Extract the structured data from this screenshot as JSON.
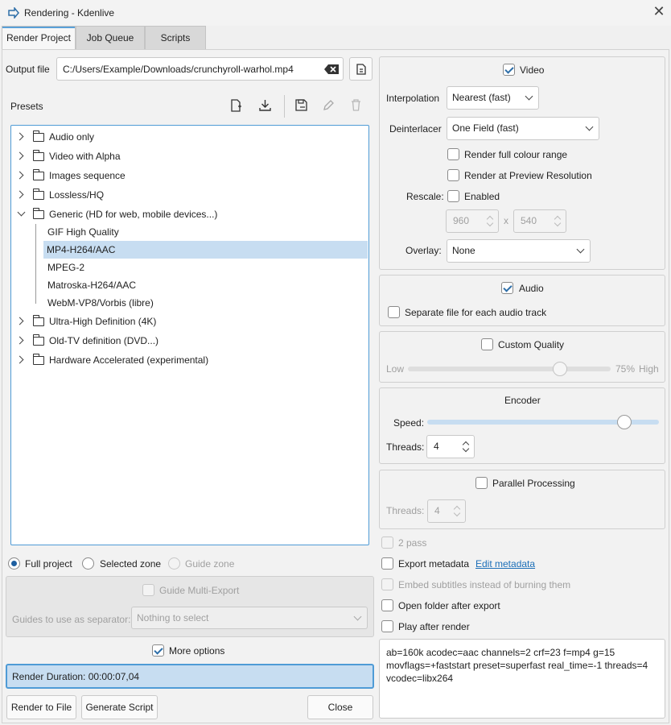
{
  "window": {
    "title": "Rendering - Kdenlive",
    "close_glyph": "✕"
  },
  "tabs": [
    {
      "label": "Render Project"
    },
    {
      "label": "Job Queue"
    },
    {
      "label": "Scripts"
    }
  ],
  "output": {
    "label": "Output file",
    "value": "C:/Users/Example/Downloads/crunchyroll-warhol.mp4"
  },
  "presets": {
    "label": "Presets",
    "tree": [
      {
        "label": "Audio only"
      },
      {
        "label": "Video with Alpha"
      },
      {
        "label": "Images sequence"
      },
      {
        "label": "Lossless/HQ"
      },
      {
        "label": "Generic (HD for web, mobile devices...)"
      },
      {
        "label": "GIF High Quality"
      },
      {
        "label": "MP4-H264/AAC"
      },
      {
        "label": "MPEG-2"
      },
      {
        "label": "Matroska-H264/AAC"
      },
      {
        "label": "WebM-VP8/Vorbis (libre)"
      },
      {
        "label": "Ultra-High Definition (4K)"
      },
      {
        "label": "Old-TV definition (DVD...)"
      },
      {
        "label": "Hardware Accelerated (experimental)"
      }
    ]
  },
  "zone": {
    "full": "Full project",
    "selected": "Selected zone",
    "guide": "Guide zone"
  },
  "guide_export": {
    "label": "Guide Multi-Export",
    "separator_label": "Guides to use as separator:",
    "separator_value": "Nothing to select"
  },
  "more_options": "More options",
  "render_duration": "Render Duration: 00:00:07,04",
  "buttons": {
    "render": "Render to File",
    "script": "Generate Script",
    "close": "Close"
  },
  "video": {
    "label": "Video",
    "interpolation_label": "Interpolation",
    "interpolation_value": "Nearest (fast)",
    "deinterlacer_label": "Deinterlacer",
    "deinterlacer_value": "One Field (fast)",
    "full_range": "Render full colour range",
    "preview_res": "Render at Preview Resolution",
    "rescale_label": "Rescale:",
    "rescale_enabled": "Enabled",
    "width": "960",
    "x": "x",
    "height": "540",
    "overlay_label": "Overlay:",
    "overlay_value": "None"
  },
  "audio": {
    "label": "Audio",
    "separate": "Separate file for each audio track"
  },
  "quality": {
    "label": "Custom Quality",
    "low": "Low",
    "value": "75%",
    "high": "High",
    "level": 0.75
  },
  "encoder": {
    "title": "Encoder",
    "speed_label": "Speed:",
    "speed_level": 0.85,
    "threads_label": "Threads:",
    "threads_value": "4"
  },
  "parallel": {
    "label": "Parallel Processing",
    "threads_label": "Threads:",
    "threads_value": "4"
  },
  "options": {
    "two_pass": "2 pass",
    "export_meta": "Export metadata",
    "edit_meta": "Edit metadata",
    "embed_subs": "Embed subtitles instead of burning them",
    "open_folder": "Open folder after export",
    "play_after": "Play after render"
  },
  "params": "ab=160k acodec=aac channels=2 crf=23 f=mp4 g=15 movflags=+faststart preset=superfast real_time=-1 threads=4 vcodec=libx264",
  "colors": {
    "accent": "#5aa0d8",
    "selection": "#c7ddf1",
    "link": "#1d6fb8"
  }
}
